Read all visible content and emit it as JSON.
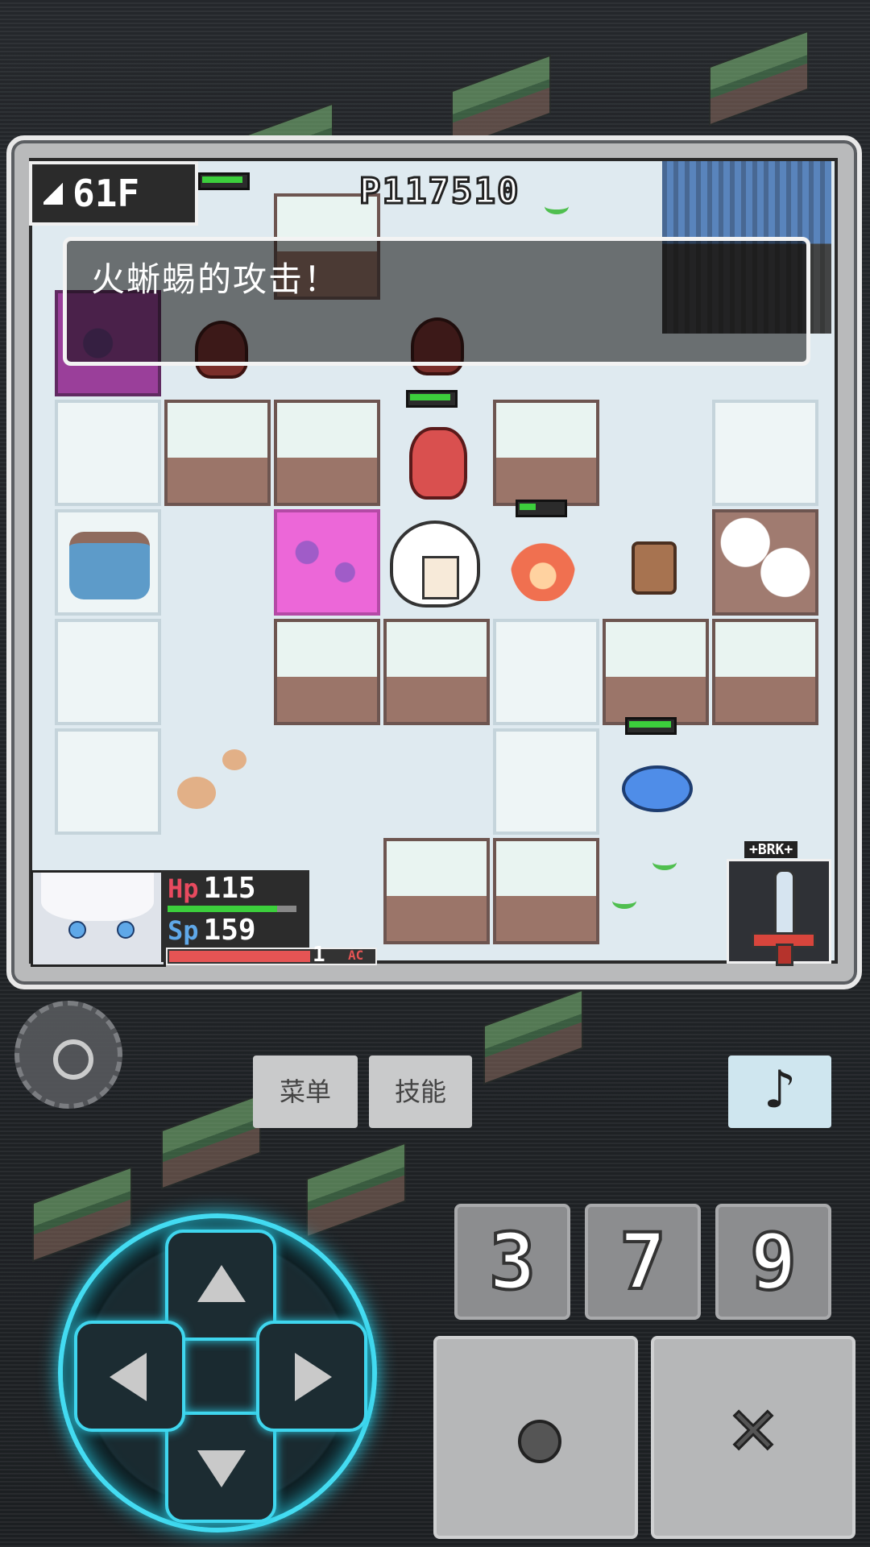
{
  "hud": {
    "floor": "61F",
    "gold": "P117510",
    "message": "火蜥蜴的攻击！"
  },
  "player": {
    "hp_label": "Hp",
    "hp_value": "115",
    "hp_fraction": 0.85,
    "sp_label": "Sp",
    "sp_value": "159",
    "sp_fraction": 0.9,
    "level": "1",
    "exp_fraction": 0.7,
    "ac_label": "AC"
  },
  "weapon": {
    "tag": "+BRK+",
    "icon": "sword-icon"
  },
  "controls": {
    "menu_label": "菜单",
    "skill_label": "技能",
    "music_icon": "music-note-icon",
    "music_glyph": "♪",
    "key3": "3",
    "key7": "7",
    "key9": "9",
    "confirm_icon": "circle-icon",
    "cancel_icon": "x-icon",
    "cancel_glyph": "✕",
    "settings_icon": "gear-icon"
  },
  "colors": {
    "dpad_glow": "#44dcf2",
    "hp_color": "#e84a5f",
    "sp_color": "#5fa8e8",
    "exp_color": "#e65454"
  }
}
